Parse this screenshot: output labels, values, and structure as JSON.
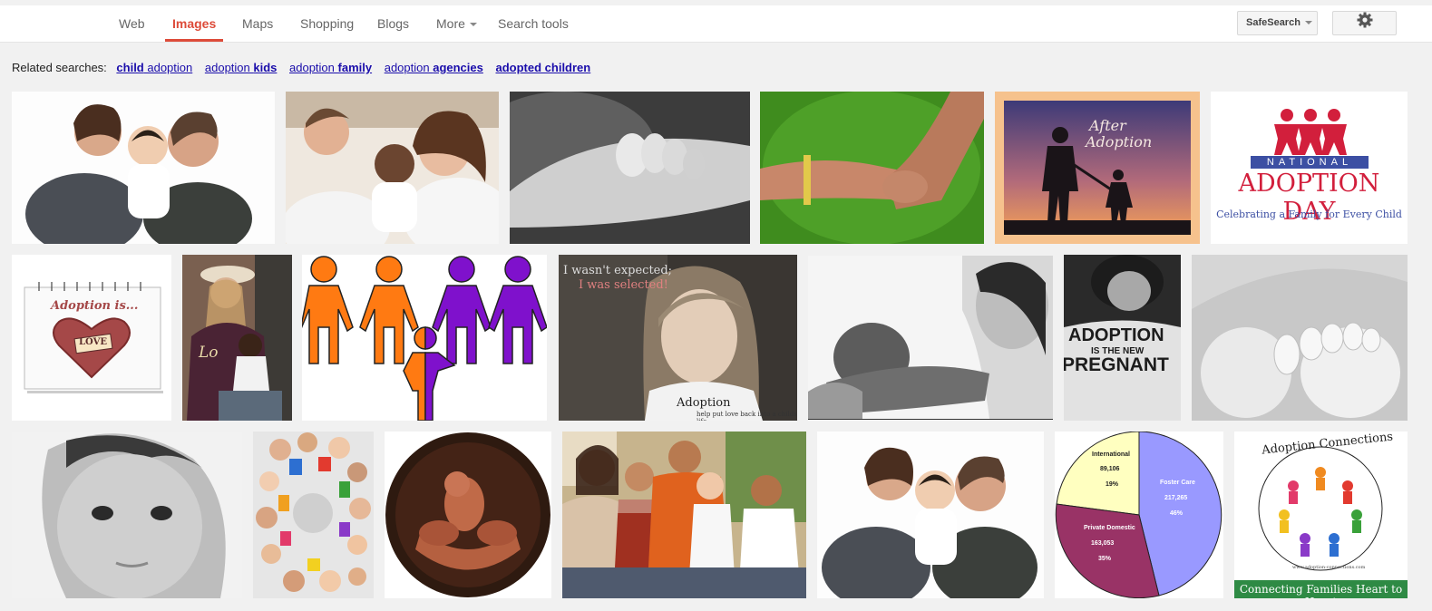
{
  "nav": {
    "tabs": [
      "Web",
      "Images",
      "Maps",
      "Shopping",
      "Blogs",
      "More",
      "Search tools"
    ],
    "active_tab": "Images",
    "safesearch_label": "SafeSearch",
    "settings_icon": "gear-icon"
  },
  "related": {
    "label": "Related searches:",
    "links": [
      {
        "normal": "",
        "bold": "child",
        "normal2": " adoption"
      },
      {
        "normal": "adoption ",
        "bold": "kids",
        "normal2": ""
      },
      {
        "normal": "adoption ",
        "bold": "family",
        "normal2": ""
      },
      {
        "normal": "adoption ",
        "bold": "agencies",
        "normal2": ""
      },
      {
        "normal": "",
        "bold": "adopted children",
        "normal2": ""
      }
    ]
  },
  "images": {
    "after_adoption_line1": "After",
    "after_adoption_line2": "Adoption",
    "nad_national": "NATIONAL",
    "nad_title": "ADOPTION DAY",
    "nad_sub": "Celebrating a Family for Every Child",
    "love_title": "Adoption is...",
    "love_word": "LOVE",
    "tshirt_word": "Lo",
    "girl_quote1": "I wasn't expected;",
    "girl_quote2": "I was selected!",
    "girl_caption": "Adoption",
    "girl_caption_sub": "help put love back into a childs life",
    "shirt_line1": "ADOPTION",
    "shirt_line2": "IS THE NEW",
    "shirt_line3": "PREGNANT",
    "pie": {
      "slices": [
        {
          "label": "International",
          "value": "89,106",
          "pct": "19%",
          "color": "#ffffc0"
        },
        {
          "label": "Foster Care",
          "value": "217,265",
          "pct": "46%",
          "color": "#9999ff"
        },
        {
          "label": "Private Domestic",
          "value": "163,053",
          "pct": "35%",
          "color": "#993366"
        }
      ]
    },
    "conn_title": "Adoption Connections",
    "conn_url": "www.adoption-connections.com",
    "conn_footer": "Connecting Families Heart to Heart"
  }
}
